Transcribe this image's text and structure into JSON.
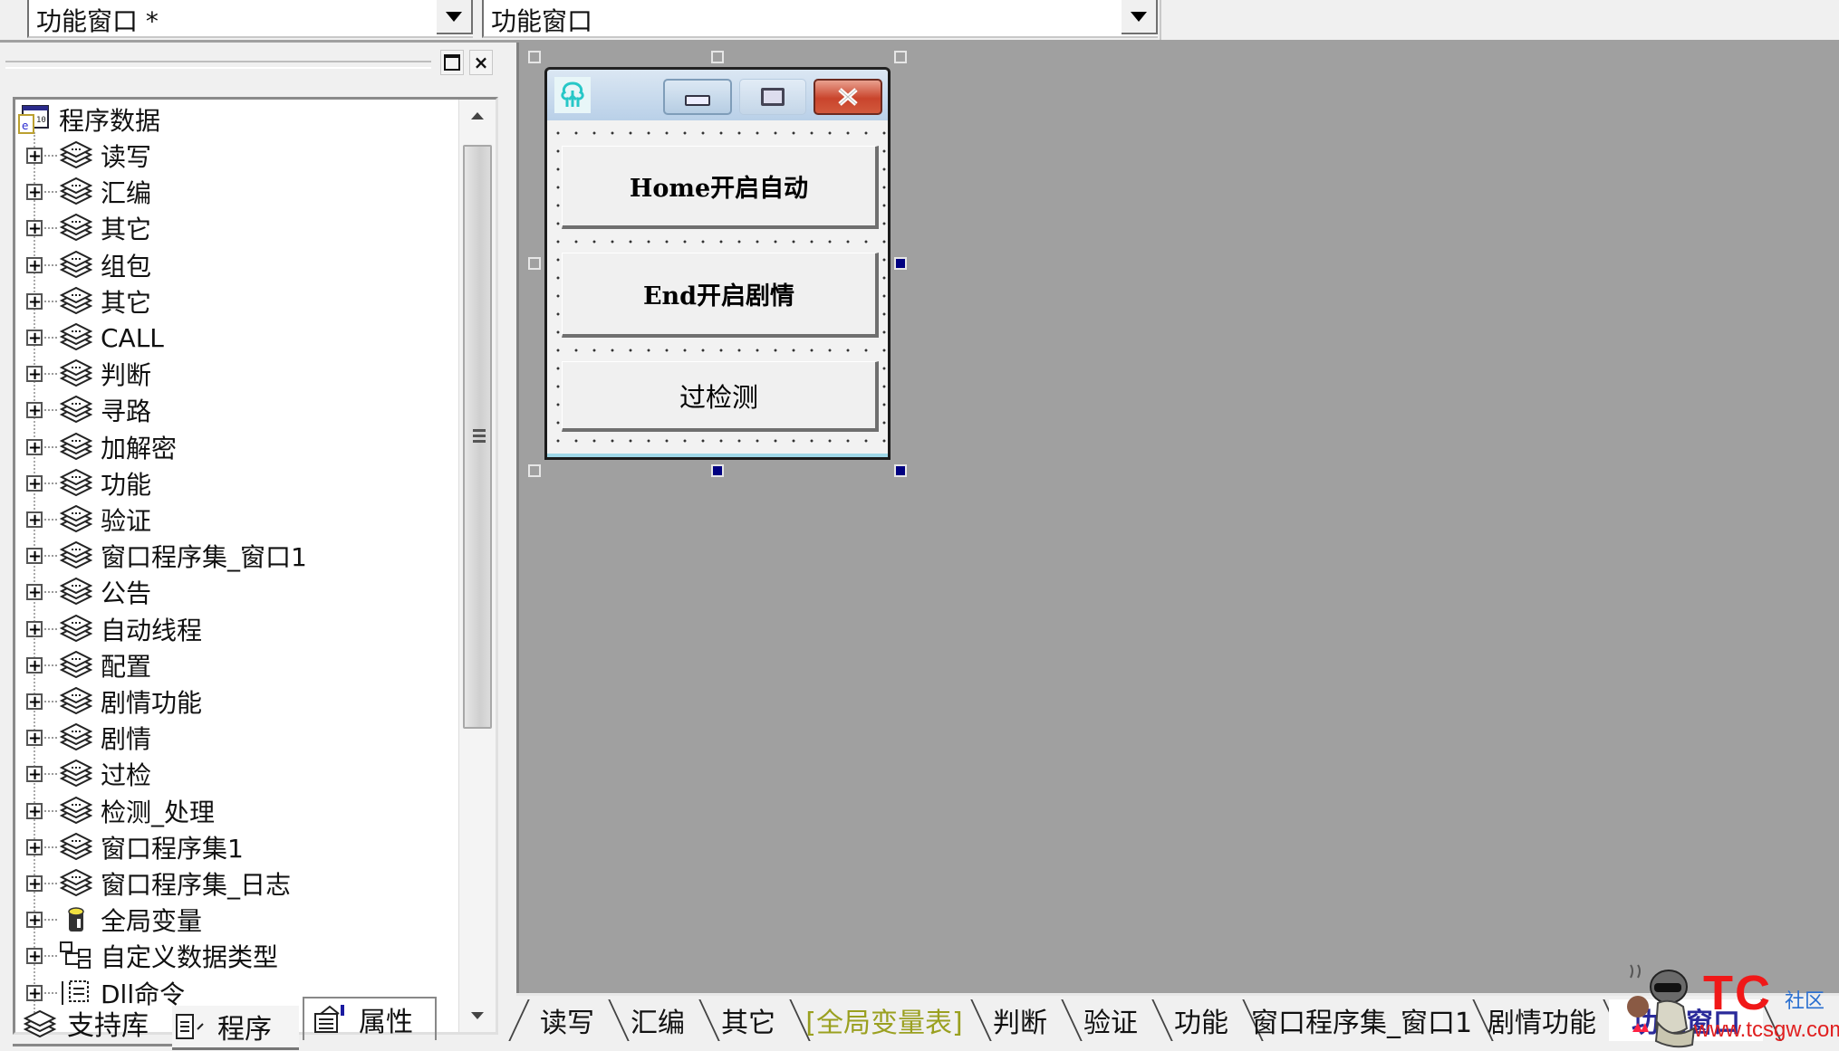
{
  "topbar": {
    "object_combo": "功能窗口 *",
    "event_combo": "功能窗口"
  },
  "left_panel": {
    "restore_label": "□",
    "close_label": "×",
    "tree": {
      "root": {
        "label": "程序数据",
        "icon": "program-data-icon"
      },
      "items": [
        {
          "label": "读写",
          "icon": "module-stack-icon"
        },
        {
          "label": "汇编",
          "icon": "module-stack-icon"
        },
        {
          "label": "其它",
          "icon": "module-stack-icon"
        },
        {
          "label": "组包",
          "icon": "module-stack-icon"
        },
        {
          "label": "其它",
          "icon": "module-stack-icon"
        },
        {
          "label": "CALL",
          "icon": "module-stack-icon"
        },
        {
          "label": "判断",
          "icon": "module-stack-icon"
        },
        {
          "label": "寻路",
          "icon": "module-stack-icon"
        },
        {
          "label": "加解密",
          "icon": "module-stack-icon"
        },
        {
          "label": "功能",
          "icon": "module-stack-icon"
        },
        {
          "label": "验证",
          "icon": "module-stack-icon"
        },
        {
          "label": "窗口程序集_窗口1",
          "icon": "module-stack-icon"
        },
        {
          "label": "公告",
          "icon": "module-stack-icon"
        },
        {
          "label": "自动线程",
          "icon": "module-stack-icon"
        },
        {
          "label": "配置",
          "icon": "module-stack-icon"
        },
        {
          "label": "剧情功能",
          "icon": "module-stack-icon"
        },
        {
          "label": "剧情",
          "icon": "module-stack-icon"
        },
        {
          "label": "过检",
          "icon": "module-stack-icon"
        },
        {
          "label": "检测_处理",
          "icon": "module-stack-icon"
        },
        {
          "label": "窗口程序集1",
          "icon": "module-stack-icon"
        },
        {
          "label": "窗口程序集_日志",
          "icon": "module-stack-icon"
        },
        {
          "label": "全局变量",
          "icon": "global-variable-icon"
        },
        {
          "label": "自定义数据类型",
          "icon": "custom-type-icon"
        },
        {
          "label": "Dll命令",
          "icon": "dll-command-icon"
        }
      ]
    },
    "tabs": [
      {
        "label": "支持库",
        "icon": "support-library-icon",
        "active": false
      },
      {
        "label": "程序",
        "icon": "program-icon",
        "active": true
      },
      {
        "label": "属性",
        "icon": "properties-icon",
        "active": false
      }
    ]
  },
  "designer": {
    "form_title_buttons": [
      "minimize",
      "maximize",
      "close"
    ],
    "buttons": [
      {
        "label": "Home开启自动"
      },
      {
        "label": "End开启剧情"
      },
      {
        "label": "过检测"
      }
    ]
  },
  "editor_tabs": [
    {
      "label": "读写",
      "active": false
    },
    {
      "label": "汇编",
      "active": false
    },
    {
      "label": "其它",
      "active": false
    },
    {
      "label": "[全局变量表]",
      "active": false,
      "highlight": "#9aa020"
    },
    {
      "label": "判断",
      "active": false
    },
    {
      "label": "验证",
      "active": false
    },
    {
      "label": "功能",
      "active": false
    },
    {
      "label": "窗口程序集_窗口1",
      "active": false
    },
    {
      "label": "剧情功能",
      "active": false
    },
    {
      "label": "功能窗口",
      "active": true
    }
  ],
  "watermark": {
    "brand": "TC",
    "community": "社区",
    "url": "www.tcsgw.com"
  },
  "colors": {
    "canvas_bg": "#a0a0a0",
    "selection_handle": "#000080",
    "active_tab_text": "#2a2a9a",
    "global_var_tab_text": "#9aa020",
    "close_button": "#c9442c"
  }
}
